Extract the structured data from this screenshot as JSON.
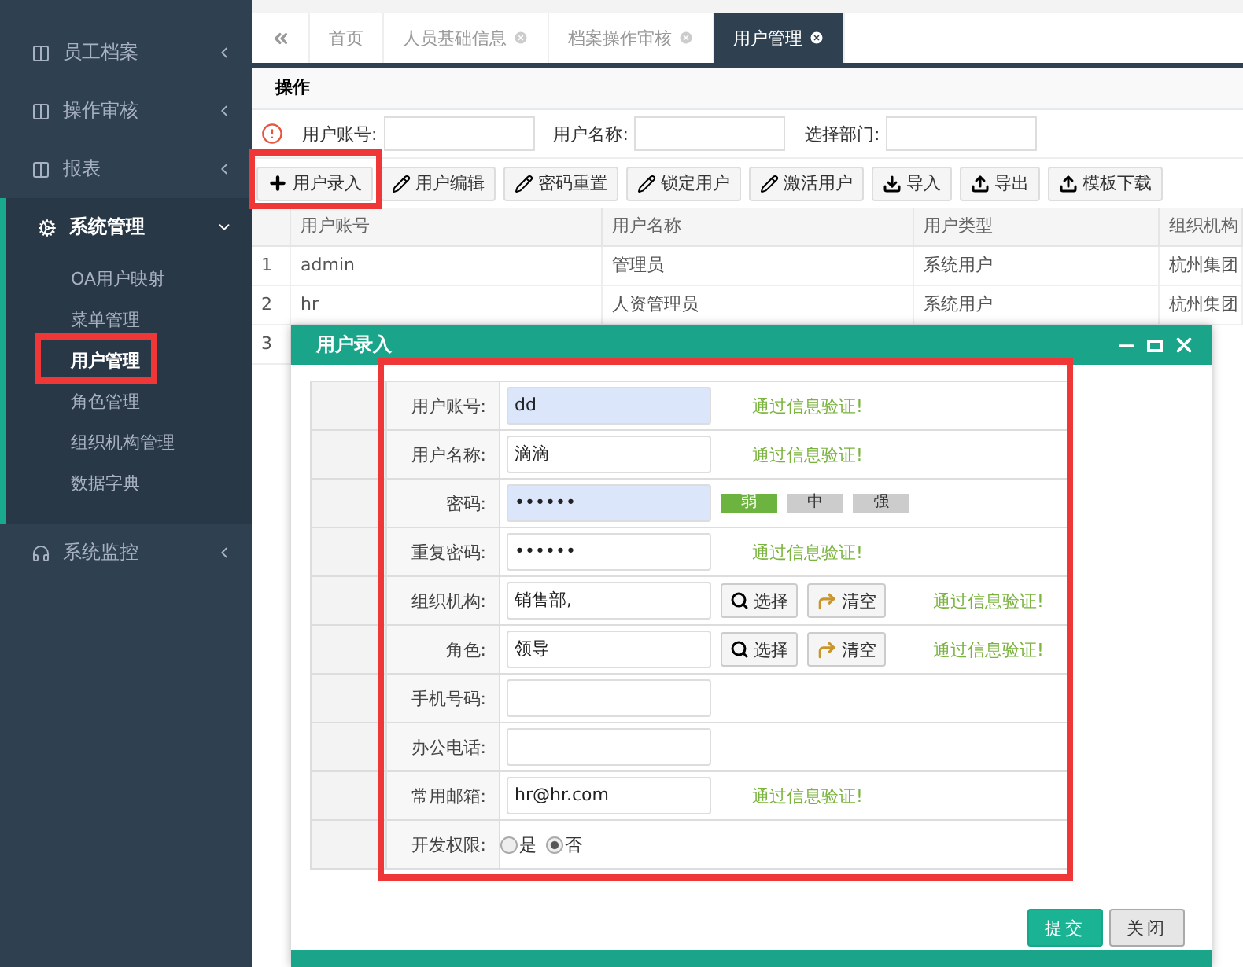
{
  "sidebar": {
    "items": [
      {
        "label": "员工档案",
        "expanded": false
      },
      {
        "label": "操作审核",
        "expanded": false
      },
      {
        "label": "报表",
        "expanded": false
      },
      {
        "label": "系统管理",
        "expanded": true,
        "children": [
          {
            "label": "OA用户映射",
            "selected": false
          },
          {
            "label": "菜单管理",
            "selected": false
          },
          {
            "label": "用户管理",
            "selected": true
          },
          {
            "label": "角色管理",
            "selected": false
          },
          {
            "label": "组织机构管理",
            "selected": false
          },
          {
            "label": "数据字典",
            "selected": false
          }
        ]
      },
      {
        "label": "系统监控",
        "expanded": false
      }
    ]
  },
  "tabs": [
    {
      "label": "首页",
      "closable": false,
      "selected": false
    },
    {
      "label": "人员基础信息",
      "closable": true,
      "selected": false
    },
    {
      "label": "档案操作审核",
      "closable": true,
      "selected": false
    },
    {
      "label": "用户管理",
      "closable": true,
      "selected": true
    }
  ],
  "panel_title": "操作",
  "search_fields": [
    {
      "label": "用户账号:"
    },
    {
      "label": "用户名称:"
    },
    {
      "label": "选择部门:"
    }
  ],
  "toolbar": [
    {
      "label": "用户录入"
    },
    {
      "label": "用户编辑"
    },
    {
      "label": "密码重置"
    },
    {
      "label": "锁定用户"
    },
    {
      "label": "激活用户"
    },
    {
      "label": "导入"
    },
    {
      "label": "导出"
    },
    {
      "label": "模板下载"
    }
  ],
  "table": {
    "columns": [
      "用户账号",
      "用户名称",
      "用户类型",
      "组织机构"
    ],
    "rows": [
      {
        "index": "1",
        "cells": [
          "admin",
          "管理员",
          "系统用户",
          "杭州集团"
        ]
      },
      {
        "index": "2",
        "cells": [
          "hr",
          "人资管理员",
          "系统用户",
          "杭州集团"
        ]
      },
      {
        "index": "3",
        "cells": []
      }
    ]
  },
  "dialog": {
    "title": "用户录入",
    "fields": [
      {
        "kind": "text",
        "label": "用户账号:",
        "value": "dd",
        "highlighted": true,
        "message": "通过信息验证!"
      },
      {
        "kind": "text",
        "label": "用户名称:",
        "value": "滴滴",
        "highlighted": false,
        "message": "通过信息验证!"
      },
      {
        "kind": "password",
        "label": "密码:",
        "value": "••••••",
        "highlighted": true,
        "strength": [
          {
            "label": "弱",
            "selected": true
          },
          {
            "label": "中",
            "selected": false
          },
          {
            "label": "强",
            "selected": false
          }
        ]
      },
      {
        "kind": "text",
        "label": "重复密码:",
        "value": "••••••",
        "highlighted": false,
        "message": "通过信息验证!"
      },
      {
        "kind": "picker",
        "label": "组织机构:",
        "value": "销售部,",
        "highlighted": false,
        "select": "选择",
        "clear": "清空",
        "message": "通过信息验证!"
      },
      {
        "kind": "picker",
        "label": "角色:",
        "value": "领导",
        "highlighted": false,
        "select": "选择",
        "clear": "清空",
        "message": "通过信息验证!"
      },
      {
        "kind": "text",
        "label": "手机号码:",
        "highlighted": false
      },
      {
        "kind": "text",
        "label": "办公电话:",
        "highlighted": false
      },
      {
        "kind": "text",
        "label": "常用邮箱:",
        "value": "hr@hr.com",
        "highlighted": false,
        "message": "通过信息验证!"
      },
      {
        "kind": "radio",
        "label": "开发权限:",
        "options": [
          {
            "label": "是",
            "selected": false
          },
          {
            "label": "否",
            "selected": true
          }
        ]
      }
    ],
    "buttons": [
      {
        "label": "提交",
        "kind": "primary"
      },
      {
        "label": "关闭",
        "kind": "default"
      }
    ]
  }
}
